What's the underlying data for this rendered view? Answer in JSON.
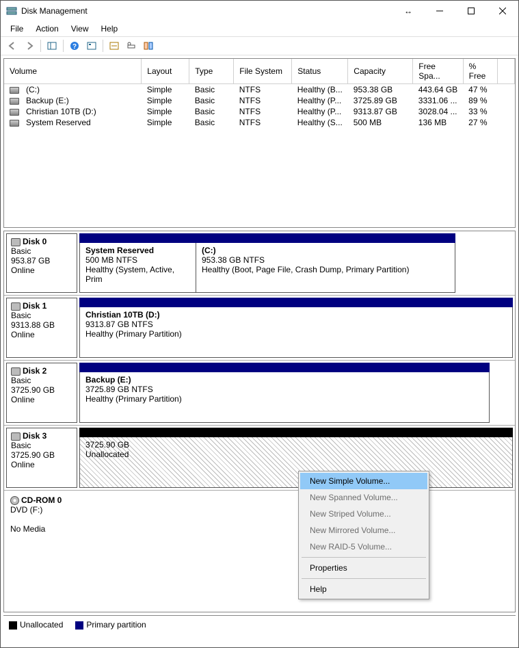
{
  "window": {
    "title": "Disk Management"
  },
  "menu": {
    "file": "File",
    "action": "Action",
    "view": "View",
    "help": "Help"
  },
  "columns": {
    "volume": "Volume",
    "layout": "Layout",
    "type": "Type",
    "fs": "File System",
    "status": "Status",
    "capacity": "Capacity",
    "free": "Free Spa...",
    "pct": "% Free"
  },
  "volumes": [
    {
      "name": " (C:)",
      "layout": "Simple",
      "type": "Basic",
      "fs": "NTFS",
      "status": "Healthy (B...",
      "capacity": "953.38 GB",
      "free": "443.64 GB",
      "pct": "47 %"
    },
    {
      "name": "Backup (E:)",
      "layout": "Simple",
      "type": "Basic",
      "fs": "NTFS",
      "status": "Healthy (P...",
      "capacity": "3725.89 GB",
      "free": "3331.06 ...",
      "pct": "89 %"
    },
    {
      "name": "Christian 10TB (D:)",
      "layout": "Simple",
      "type": "Basic",
      "fs": "NTFS",
      "status": "Healthy (P...",
      "capacity": "9313.87 GB",
      "free": "3028.04 ...",
      "pct": "33 %"
    },
    {
      "name": "System Reserved",
      "layout": "Simple",
      "type": "Basic",
      "fs": "NTFS",
      "status": "Healthy (S...",
      "capacity": "500 MB",
      "free": "136 MB",
      "pct": "27 %"
    }
  ],
  "disks": {
    "d0": {
      "name": "Disk 0",
      "type": "Basic",
      "size": "953.87 GB",
      "state": "Online",
      "p0": {
        "name": "System Reserved",
        "size": "500 MB NTFS",
        "status": "Healthy (System, Active, Prim"
      },
      "p1": {
        "name": " (C:)",
        "size": "953.38 GB NTFS",
        "status": "Healthy (Boot, Page File, Crash Dump, Primary Partition)"
      }
    },
    "d1": {
      "name": "Disk 1",
      "type": "Basic",
      "size": "9313.88 GB",
      "state": "Online",
      "p0": {
        "name": "Christian 10TB  (D:)",
        "size": "9313.87 GB NTFS",
        "status": "Healthy (Primary Partition)"
      }
    },
    "d2": {
      "name": "Disk 2",
      "type": "Basic",
      "size": "3725.90 GB",
      "state": "Online",
      "p0": {
        "name": "Backup  (E:)",
        "size": "3725.89 GB NTFS",
        "status": "Healthy (Primary Partition)"
      }
    },
    "d3": {
      "name": "Disk 3",
      "type": "Basic",
      "size": "3725.90 GB",
      "state": "Online",
      "p0": {
        "name": "",
        "size": "3725.90 GB",
        "status": "Unallocated"
      }
    },
    "cd": {
      "name": "CD-ROM 0",
      "type": "DVD (F:)",
      "size": "",
      "state": "No Media"
    }
  },
  "ctx": {
    "new_simple": "New Simple Volume...",
    "new_spanned": "New Spanned Volume...",
    "new_striped": "New Striped Volume...",
    "new_mirrored": "New Mirrored Volume...",
    "new_raid5": "New RAID-5 Volume...",
    "properties": "Properties",
    "help": "Help"
  },
  "legend": {
    "unalloc": "Unallocated",
    "primary": "Primary partition"
  }
}
